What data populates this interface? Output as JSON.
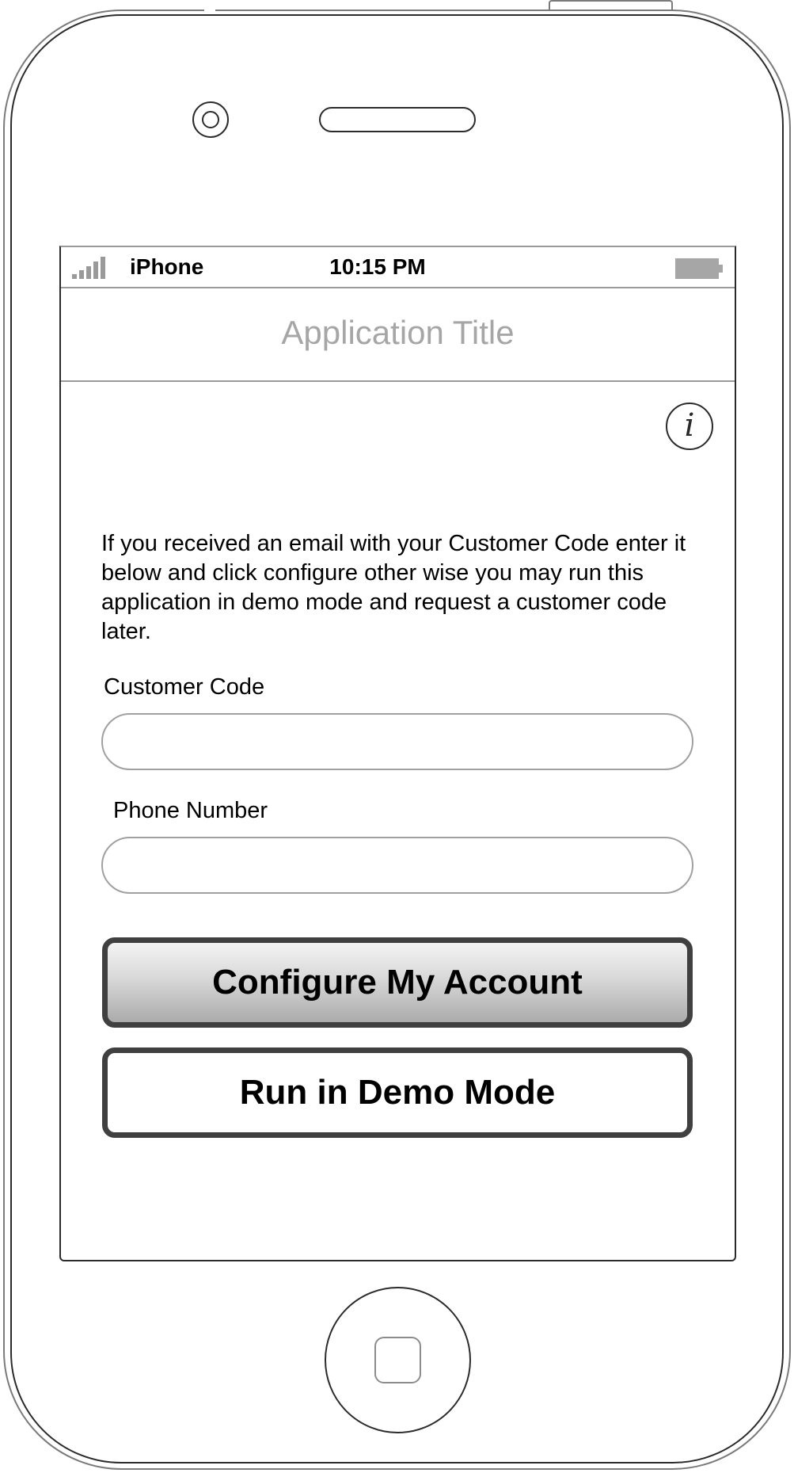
{
  "status_bar": {
    "carrier": "iPhone",
    "time": "10:15 PM",
    "signal_icon": "signal-bars-icon",
    "battery_icon": "battery-icon"
  },
  "nav_bar": {
    "title": "Application Title"
  },
  "info_button": {
    "icon": "info-icon",
    "glyph": "i"
  },
  "content": {
    "intro_text": "If you received an email with your Customer Code enter it below and click configure other wise you may run this application in demo mode and request a customer code later.",
    "customer_code": {
      "label": "Customer Code",
      "value": "",
      "placeholder": ""
    },
    "phone_number": {
      "label": "Phone Number",
      "value": "",
      "placeholder": ""
    },
    "configure_button": "Configure My Account",
    "demo_button": "Run in Demo Mode"
  },
  "colors": {
    "frame_stroke": "#2b2b2b",
    "outer_stroke": "#7a7a7a",
    "title_gray": "#a6a6a6",
    "field_border": "#a0a0a0",
    "button_border": "#404040"
  }
}
